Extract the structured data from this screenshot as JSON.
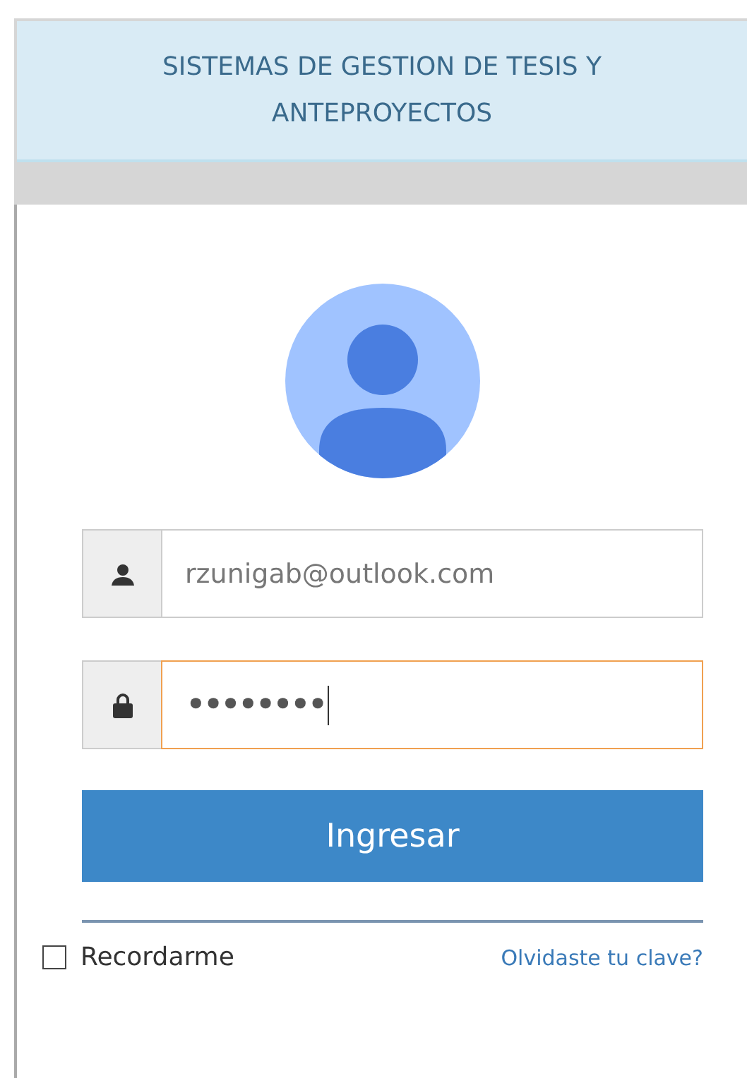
{
  "header": {
    "title": "SISTEMAS DE GESTION DE TESIS Y ANTEPROYECTOS"
  },
  "form": {
    "fields": [
      {
        "kind": "user",
        "value": "rzunigab@outlook.com",
        "focused": false
      },
      {
        "kind": "password",
        "value": "••••••••",
        "focused": true
      }
    ],
    "submit": "Ingresar",
    "remember": {
      "label": "Recordarme",
      "checked": false
    },
    "forgot": "Olvidaste tu clave?"
  }
}
